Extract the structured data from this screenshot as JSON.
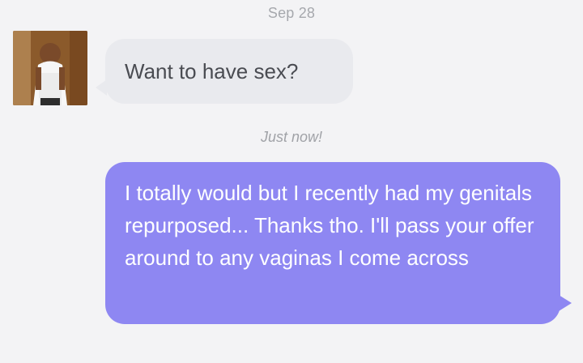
{
  "conversation": {
    "date_label": "Sep 28",
    "incoming_message": "Want to have sex?",
    "recent_label": "Just now!",
    "outgoing_message": "I totally would but I recently had my genitals repurposed... Thanks tho. I'll pass your offer around to any vaginas I come across"
  },
  "colors": {
    "background": "#f3f3f5",
    "incoming_bubble": "#e9eaee",
    "outgoing_bubble": "#8e87f2",
    "date_text": "#a6a8ad",
    "incoming_text": "#4a4c52",
    "outgoing_text": "#ffffff"
  },
  "icons": {
    "avatar": "contact-avatar-photo"
  }
}
